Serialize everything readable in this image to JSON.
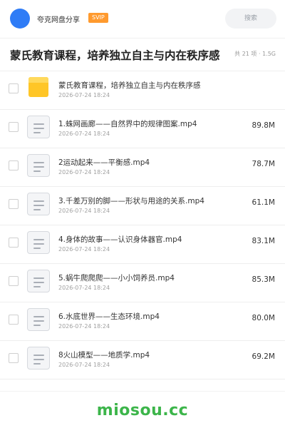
{
  "header": {
    "username": "夸克网盘分享",
    "badge": "SVIP",
    "search_label": "搜索"
  },
  "title_bar": {
    "title": "蒙氏教育课程，培养独立自主与内在秩序感",
    "summary": "共 21 项 · 1.5G"
  },
  "files": [
    {
      "name": "蒙氏教育课程，培养独立自主与内在秩序感",
      "date": "2026-07-24 18:24",
      "size": "",
      "icon": "folder-icon"
    },
    {
      "name": "1.蛛网画廊——自然界中的规律图案.mp4",
      "date": "2026-07-24 18:24",
      "size": "89.8M",
      "icon": "file-icon"
    },
    {
      "name": "2运动起来——平衡感.mp4",
      "date": "2026-07-24 18:24",
      "size": "78.7M",
      "icon": "file-icon"
    },
    {
      "name": "3.千差万别的脚——形状与用途的关系.mp4",
      "date": "2026-07-24 18:24",
      "size": "61.1M",
      "icon": "file-icon"
    },
    {
      "name": "4.身体的故事——认识身体器官.mp4",
      "date": "2026-07-24 18:24",
      "size": "83.1M",
      "icon": "file-icon"
    },
    {
      "name": "5.蜗牛爬爬爬——小小饲养员.mp4",
      "date": "2026-07-24 18:24",
      "size": "85.3M",
      "icon": "file-icon"
    },
    {
      "name": "6.水底世界——生态环境.mp4",
      "date": "2026-07-24 18:24",
      "size": "80.0M",
      "icon": "file-icon"
    },
    {
      "name": "8火山模型——地质学.mp4",
      "date": "2026-07-24 18:24",
      "size": "69.2M",
      "icon": "file-icon"
    }
  ],
  "watermark": "miosou.cc",
  "colors": {
    "avatar": "#2f7cf6",
    "vip_badge": "#ff9a2e",
    "folder": "#ffc627",
    "watermark": "#3cb54a"
  }
}
